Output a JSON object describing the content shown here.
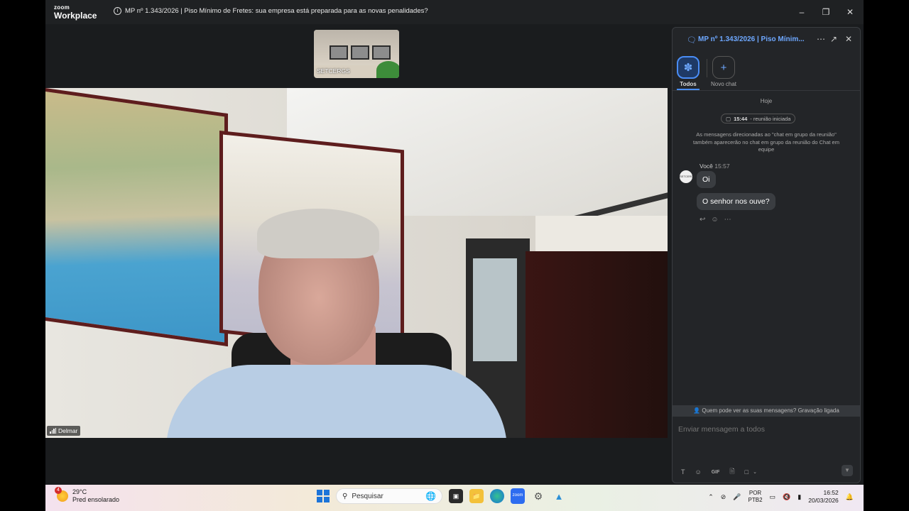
{
  "window": {
    "app_brand_top": "zoom",
    "app_brand_bottom": "Workplace",
    "meeting_title": "MP nº 1.343/2026 | Piso Mínimo de Fretes: sua empresa está preparada para as novas penalidades?",
    "controls": [
      "minimize-icon",
      "restore-icon",
      "close-icon"
    ]
  },
  "video": {
    "thumbnail_name": "SETCERGS",
    "speaker_name": "Delmar"
  },
  "chat": {
    "title": "MP nº 1.343/2026 | Piso Mínim...",
    "tabs": [
      {
        "label": "Todos",
        "icon": "people-icon",
        "active": true
      },
      {
        "label": "Novo chat",
        "icon": "plus-icon",
        "active": false
      }
    ],
    "date_label": "Hoje",
    "meeting_started_time": "15:44",
    "meeting_started_text": "- reunião iniciada",
    "notice": "As mensagens direcionadas ao \"chat em grupo da reunião\" também aparecerão no chat em grupo da reunião do Chat em equipe",
    "sender": "Você",
    "sender_time": "15:57",
    "avatar_text": "SETCERGS",
    "messages": [
      "Oi",
      "O senhor nos ouve?"
    ],
    "privacy": "Quem pode ver as suas mensagens? Gravação ligada",
    "compose_placeholder": "Enviar mensagem a todos",
    "toolbar": [
      "text-format-icon",
      "emoji-icon",
      "gif-icon",
      "file-icon",
      "screenshot-icon",
      "chevron-down-icon"
    ],
    "gif_label": "GIF"
  },
  "taskbar": {
    "weather_badge": "4",
    "temperature": "29°C",
    "weather_desc": "Pred ensolarado",
    "search_label": "Pesquisar",
    "lang_top": "POR",
    "lang_bottom": "PTB2",
    "time": "16:52",
    "date": "20/03/2026"
  },
  "colors": {
    "accent": "#4a8df6",
    "chat_title": "#6ea8ff",
    "panel_bg": "#232528",
    "app_bg": "#1a1c1e"
  }
}
